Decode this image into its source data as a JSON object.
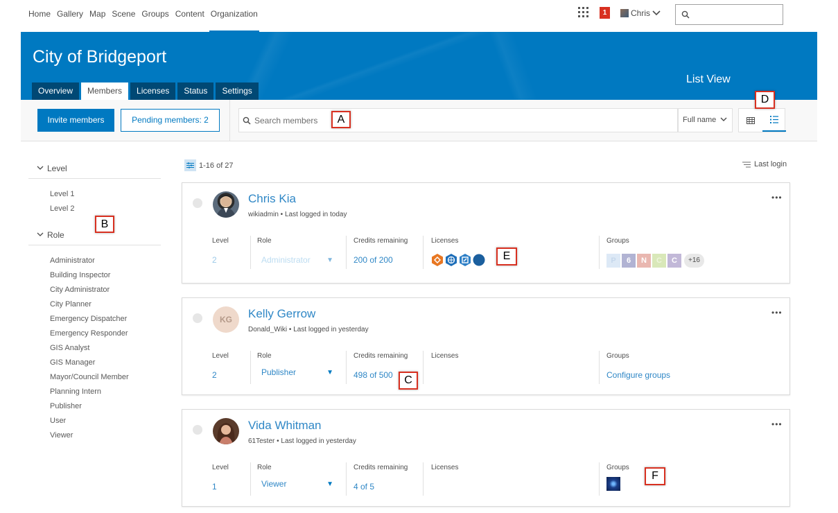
{
  "topnav": {
    "links": [
      "Home",
      "Gallery",
      "Map",
      "Scene",
      "Groups",
      "Content",
      "Organization"
    ],
    "notification_count": "1",
    "user_name": "Chris"
  },
  "banner": {
    "org_name": "City of Bridgeport",
    "view_label": "List View",
    "tabs": [
      "Overview",
      "Members",
      "Licenses",
      "Status",
      "Settings"
    ],
    "active_tab": "Members"
  },
  "toolbar": {
    "invite_label": "Invite members",
    "pending_label": "Pending members: 2",
    "search_placeholder": "Search members",
    "search_field": "Full name"
  },
  "callouts": [
    "A",
    "B",
    "C",
    "D",
    "E",
    "F"
  ],
  "sidebar": {
    "level_heading": "Level",
    "levels": [
      "Level 1",
      "Level 2"
    ],
    "role_heading": "Role",
    "roles": [
      "Administrator",
      "Building Inspector",
      "City Administrator",
      "City Planner",
      "Emergency Dispatcher",
      "Emergency Responder",
      "GIS Analyst",
      "GIS Manager",
      "Mayor/Council Member",
      "Planning Intern",
      "Publisher",
      "User",
      "Viewer"
    ]
  },
  "results": {
    "count_label": "1-16 of 27",
    "sort_label": "Last login"
  },
  "column_labels": {
    "level": "Level",
    "role": "Role",
    "credits": "Credits remaining",
    "licenses": "Licenses",
    "groups": "Groups"
  },
  "members": [
    {
      "name": "Chris Kia",
      "subtitle": "wikiadmin • Last logged in today",
      "level": "2",
      "role": "Administrator",
      "credits": "200 of 200",
      "groups_more": "+16",
      "group_letters": [
        "P",
        "6",
        "N",
        "C",
        "C"
      ]
    },
    {
      "name": "Kelly Gerrow",
      "initials": "KG",
      "subtitle": "Donald_Wiki • Last logged in yesterday",
      "level": "2",
      "role": "Publisher",
      "credits": "498 of 500",
      "groups_link": "Configure groups"
    },
    {
      "name": "Vida Whitman",
      "subtitle": "61Tester • Last logged in yesterday",
      "level": "1",
      "role": "Viewer",
      "credits": "4 of 5"
    }
  ]
}
